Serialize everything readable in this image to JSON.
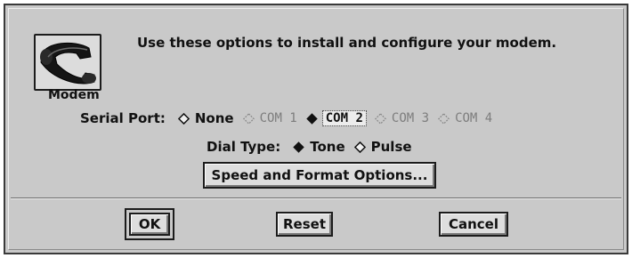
{
  "dialog": {
    "icon_label": "Modem",
    "intro_text": "Use these options to install and configure your modem."
  },
  "serial_port": {
    "label": "Serial Port:",
    "options": [
      {
        "label": "None",
        "state": "unselected",
        "enabled": true
      },
      {
        "label": "COM 1",
        "state": "unselected",
        "enabled": false
      },
      {
        "label": "COM 2",
        "state": "selected",
        "enabled": true
      },
      {
        "label": "COM 3",
        "state": "unselected",
        "enabled": false
      },
      {
        "label": "COM 4",
        "state": "unselected",
        "enabled": false
      }
    ]
  },
  "dial_type": {
    "label": "Dial Type:",
    "options": [
      {
        "label": "Tone",
        "state": "selected"
      },
      {
        "label": "Pulse",
        "state": "unselected"
      }
    ]
  },
  "buttons": {
    "speed_format": "Speed and Format Options...",
    "ok": "OK",
    "reset": "Reset",
    "cancel": "Cancel"
  },
  "icons": {
    "modem": "telephone-handset-icon",
    "radio_selected": "filled-diamond",
    "radio_unselected": "hollow-diamond"
  },
  "colors": {
    "dialog_bg": "#c9c9c9",
    "button_bg": "#dedede",
    "disabled_text": "#7d7d7d"
  }
}
